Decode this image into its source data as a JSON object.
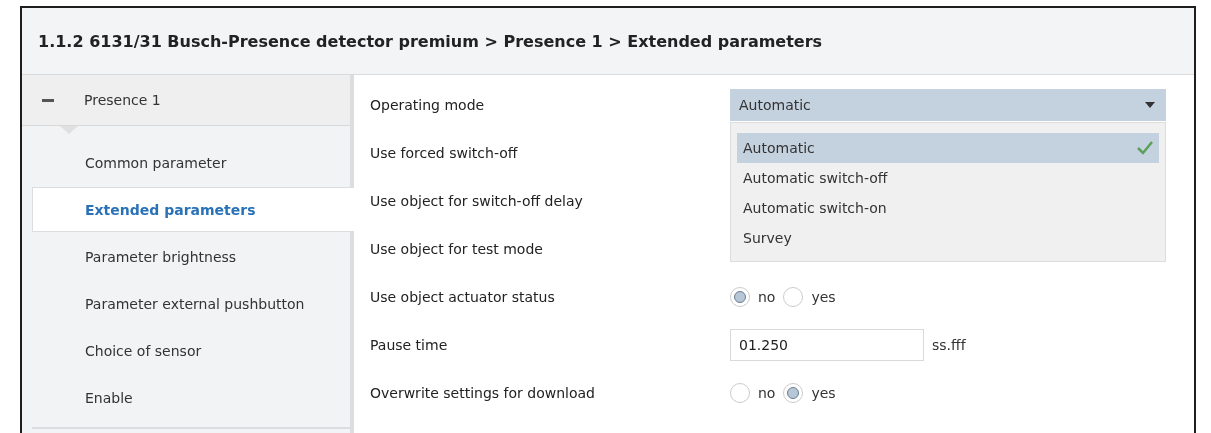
{
  "window": {
    "title": "1.1.2 6131/31 Busch-Presence detector premium > Presence 1 > Extended parameters"
  },
  "sidebar": {
    "group": {
      "label": "Presence 1",
      "expanded": true
    },
    "items": [
      {
        "label": "Common parameter",
        "selected": false
      },
      {
        "label": "Extended parameters",
        "selected": true
      },
      {
        "label": "Parameter brightness",
        "selected": false
      },
      {
        "label": "Parameter external pushbutton",
        "selected": false
      },
      {
        "label": "Choice of sensor",
        "selected": false
      },
      {
        "label": "Enable",
        "selected": false
      }
    ]
  },
  "parameters": [
    {
      "label": "Operating mode",
      "kind": "dropdown",
      "value": "Automatic",
      "expanded": true,
      "options": [
        {
          "label": "Automatic",
          "selected": true
        },
        {
          "label": "Automatic switch-off",
          "selected": false
        },
        {
          "label": "Automatic switch-on",
          "selected": false
        },
        {
          "label": "Survey",
          "selected": false
        }
      ]
    },
    {
      "label": "Use forced switch-off",
      "kind": "label"
    },
    {
      "label": "Use object for switch-off delay",
      "kind": "label"
    },
    {
      "label": "Use object for test mode",
      "kind": "label"
    },
    {
      "label": "Use object actuator status",
      "kind": "radio",
      "options": [
        {
          "label": "no",
          "selected": true
        },
        {
          "label": "yes",
          "selected": false
        }
      ]
    },
    {
      "label": "Pause time",
      "kind": "text",
      "value": "01.250",
      "unit": "ss.fff"
    },
    {
      "label": "Overwrite settings for download",
      "kind": "radio",
      "options": [
        {
          "label": "no",
          "selected": false
        },
        {
          "label": "yes",
          "selected": true
        }
      ]
    }
  ]
}
